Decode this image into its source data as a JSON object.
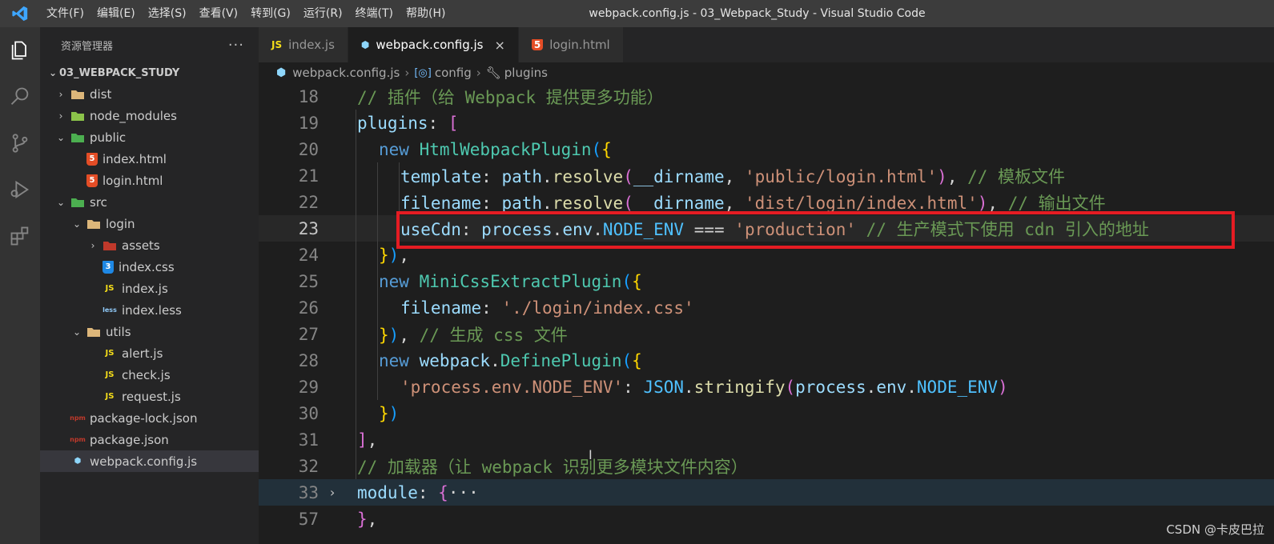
{
  "menu": [
    "文件(F)",
    "编辑(E)",
    "选择(S)",
    "查看(V)",
    "转到(G)",
    "运行(R)",
    "终端(T)",
    "帮助(H)"
  ],
  "window_title": "webpack.config.js - 03_Webpack_Study - Visual Studio Code",
  "sidebar": {
    "title": "资源管理器",
    "more": "···",
    "project": "03_WEBPACK_STUDY",
    "items": [
      {
        "label": "dist",
        "depth": 0,
        "twisty": "›",
        "icon": "folder-icon",
        "icolor": "#dcb67a"
      },
      {
        "label": "node_modules",
        "depth": 0,
        "twisty": "›",
        "icon": "node-folder-icon",
        "icolor": "#8bc34a"
      },
      {
        "label": "public",
        "depth": 0,
        "twisty": "⌄",
        "icon": "public-folder-icon",
        "icolor": "#4caf50"
      },
      {
        "label": "index.html",
        "depth": 1,
        "twisty": "",
        "icon": "html5-icon",
        "icolor": "#e44d26",
        "glyph": "5"
      },
      {
        "label": "login.html",
        "depth": 1,
        "twisty": "",
        "icon": "html5-icon",
        "icolor": "#e44d26",
        "glyph": "5"
      },
      {
        "label": "src",
        "depth": 0,
        "twisty": "⌄",
        "icon": "src-folder-icon",
        "icolor": "#4caf50"
      },
      {
        "label": "login",
        "depth": 1,
        "twisty": "⌄",
        "icon": "folder-open-icon",
        "icolor": "#dcb67a"
      },
      {
        "label": "assets",
        "depth": 2,
        "twisty": "›",
        "icon": "assets-folder-icon",
        "icolor": "#c0392b"
      },
      {
        "label": "index.css",
        "depth": 2,
        "twisty": "",
        "icon": "css3-icon",
        "icolor": "#1e88e5",
        "glyph": "3"
      },
      {
        "label": "index.js",
        "depth": 2,
        "twisty": "",
        "icon": "js-icon",
        "icolor": "#f5de19",
        "glyph": "JS"
      },
      {
        "label": "index.less",
        "depth": 2,
        "twisty": "",
        "icon": "less-icon",
        "icolor": "#90caf9",
        "glyph": "less"
      },
      {
        "label": "utils",
        "depth": 1,
        "twisty": "⌄",
        "icon": "utils-folder-icon",
        "icolor": "#dcb67a"
      },
      {
        "label": "alert.js",
        "depth": 2,
        "twisty": "",
        "icon": "js-icon",
        "icolor": "#f5de19",
        "glyph": "JS"
      },
      {
        "label": "check.js",
        "depth": 2,
        "twisty": "",
        "icon": "js-icon",
        "icolor": "#f5de19",
        "glyph": "JS"
      },
      {
        "label": "request.js",
        "depth": 2,
        "twisty": "",
        "icon": "js-icon",
        "icolor": "#f5de19",
        "glyph": "JS"
      },
      {
        "label": "package-lock.json",
        "depth": 0,
        "twisty": "",
        "icon": "npm-icon",
        "icolor": "#c0392b",
        "glyph": "npm"
      },
      {
        "label": "package.json",
        "depth": 0,
        "twisty": "",
        "icon": "npm-icon",
        "icolor": "#c0392b",
        "glyph": "npm"
      },
      {
        "label": "webpack.config.js",
        "depth": 0,
        "twisty": "",
        "icon": "webpack-icon",
        "icolor": "#8ed6fb",
        "glyph": "⬢",
        "selected": true
      }
    ]
  },
  "tabs": [
    {
      "label": "index.js",
      "icon": "js-icon",
      "glyph": "JS",
      "icolor": "#f5de19",
      "active": false
    },
    {
      "label": "webpack.config.js",
      "icon": "webpack-icon",
      "glyph": "⬢",
      "icolor": "#8ed6fb",
      "active": true,
      "close": "×"
    },
    {
      "label": "login.html",
      "icon": "html5-icon",
      "glyph": "5",
      "icolor": "#e44d26",
      "active": false
    }
  ],
  "breadcrumb": {
    "file": "webpack.config.js",
    "item1": "config",
    "item2": "plugins",
    "sep": "›"
  },
  "code_lines": [
    {
      "n": "18",
      "indent": 1,
      "tokens": [
        [
          "c",
          "// 插件（给 Webpack 提供更多功能）"
        ]
      ]
    },
    {
      "n": "19",
      "indent": 1,
      "tokens": [
        [
          "p",
          "plugins"
        ],
        [
          "w",
          ": "
        ],
        [
          "b2",
          "["
        ]
      ]
    },
    {
      "n": "20",
      "indent": 2,
      "tokens": [
        [
          "k",
          "new "
        ],
        [
          "cls",
          "HtmlWebpackPlugin"
        ],
        [
          "b3",
          "("
        ],
        [
          "b1",
          "{"
        ]
      ]
    },
    {
      "n": "21",
      "indent": 3,
      "tokens": [
        [
          "p",
          "template"
        ],
        [
          "w",
          ": "
        ],
        [
          "p",
          "path"
        ],
        [
          "w",
          "."
        ],
        [
          "f",
          "resolve"
        ],
        [
          "b2",
          "("
        ],
        [
          "p",
          "__dirname"
        ],
        [
          "w",
          ", "
        ],
        [
          "s",
          "'public/login.html'"
        ],
        [
          "b2",
          ")"
        ],
        [
          "w",
          ", "
        ],
        [
          "c",
          "// 模板文件"
        ]
      ]
    },
    {
      "n": "22",
      "indent": 3,
      "tokens": [
        [
          "p",
          "filename"
        ],
        [
          "w",
          ": "
        ],
        [
          "p",
          "path"
        ],
        [
          "w",
          "."
        ],
        [
          "f",
          "resolve"
        ],
        [
          "b2",
          "("
        ],
        [
          "p",
          "__dirname"
        ],
        [
          "w",
          ", "
        ],
        [
          "s",
          "'dist/login/index.html'"
        ],
        [
          "b2",
          ")"
        ],
        [
          "w",
          ", "
        ],
        [
          "c",
          "// 输出文件"
        ]
      ]
    },
    {
      "n": "23",
      "indent": 3,
      "current": true,
      "tokens": [
        [
          "p",
          "useCdn"
        ],
        [
          "w",
          ": "
        ],
        [
          "p",
          "process"
        ],
        [
          "w",
          "."
        ],
        [
          "p",
          "env"
        ],
        [
          "w",
          "."
        ],
        [
          "cst",
          "NODE_ENV"
        ],
        [
          "w",
          " === "
        ],
        [
          "s",
          "'production'"
        ],
        [
          "w",
          " "
        ],
        [
          "c",
          "// 生产模式下使用 cdn 引入的地址"
        ]
      ]
    },
    {
      "n": "24",
      "indent": 2,
      "tokens": [
        [
          "b1",
          "}"
        ],
        [
          "b3",
          ")"
        ],
        [
          "w",
          ","
        ]
      ]
    },
    {
      "n": "25",
      "indent": 2,
      "tokens": [
        [
          "k",
          "new "
        ],
        [
          "cls",
          "MiniCssExtractPlugin"
        ],
        [
          "b3",
          "("
        ],
        [
          "b1",
          "{"
        ]
      ]
    },
    {
      "n": "26",
      "indent": 3,
      "tokens": [
        [
          "p",
          "filename"
        ],
        [
          "w",
          ": "
        ],
        [
          "s",
          "'./login/index.css'"
        ]
      ]
    },
    {
      "n": "27",
      "indent": 2,
      "tokens": [
        [
          "b1",
          "}"
        ],
        [
          "b3",
          ")"
        ],
        [
          "w",
          ", "
        ],
        [
          "c",
          "// 生成 css 文件"
        ]
      ]
    },
    {
      "n": "28",
      "indent": 2,
      "tokens": [
        [
          "k",
          "new "
        ],
        [
          "p",
          "webpack"
        ],
        [
          "w",
          "."
        ],
        [
          "cls",
          "DefinePlugin"
        ],
        [
          "b3",
          "("
        ],
        [
          "b1",
          "{"
        ]
      ]
    },
    {
      "n": "29",
      "indent": 3,
      "tokens": [
        [
          "s",
          "'process.env.NODE_ENV'"
        ],
        [
          "w",
          ": "
        ],
        [
          "cst",
          "JSON"
        ],
        [
          "w",
          "."
        ],
        [
          "f",
          "stringify"
        ],
        [
          "b2",
          "("
        ],
        [
          "p",
          "process"
        ],
        [
          "w",
          "."
        ],
        [
          "p",
          "env"
        ],
        [
          "w",
          "."
        ],
        [
          "cst",
          "NODE_ENV"
        ],
        [
          "b2",
          ")"
        ]
      ]
    },
    {
      "n": "30",
      "indent": 2,
      "tokens": [
        [
          "b1",
          "}"
        ],
        [
          "b3",
          ")"
        ]
      ]
    },
    {
      "n": "31",
      "indent": 1,
      "tokens": [
        [
          "b2",
          "]"
        ],
        [
          "w",
          ","
        ]
      ]
    },
    {
      "n": "32",
      "indent": 1,
      "tokens": [
        [
          "c",
          "// 加载器（让 webpack 识别更多模块文件内容）"
        ]
      ]
    },
    {
      "n": "33",
      "indent": 1,
      "folded": true,
      "fold": "›",
      "tokens": [
        [
          "p",
          "module"
        ],
        [
          "w",
          ": "
        ],
        [
          "b2",
          "{"
        ],
        [
          "w",
          "···"
        ]
      ]
    },
    {
      "n": "57",
      "indent": 1,
      "tokens": [
        [
          "b2",
          "}"
        ],
        [
          "w",
          ","
        ]
      ]
    }
  ],
  "watermark": "CSDN @卡皮巴拉",
  "cursor_glyph": "I"
}
